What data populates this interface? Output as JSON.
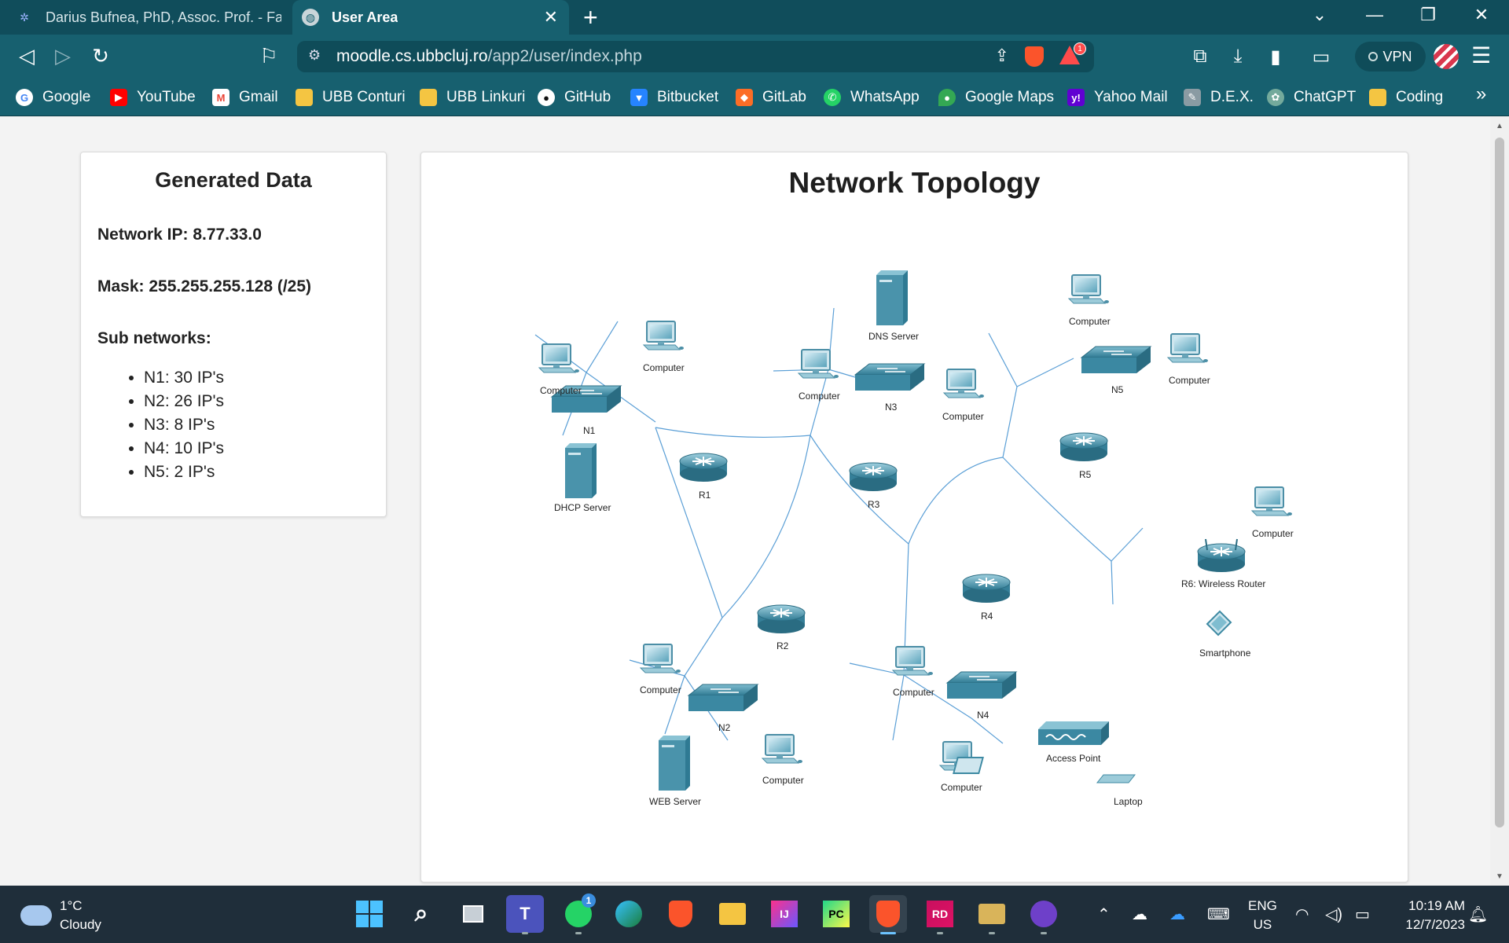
{
  "browser": {
    "tabs": [
      {
        "title": "Darius Bufnea, PhD, Assoc. Prof. - Facu",
        "active": false
      },
      {
        "title": "User Area",
        "active": true
      }
    ],
    "url_host": "moodle.cs.ubbcluj.ro",
    "url_path": "/app2/user/index.php",
    "brave_badge": "1",
    "vpn_label": "VPN",
    "bookmarks": [
      {
        "label": "Google",
        "icon": "google-icon",
        "color": "#4285f4"
      },
      {
        "label": "YouTube",
        "icon": "youtube-icon",
        "color": "#ff0000"
      },
      {
        "label": "Gmail",
        "icon": "gmail-icon",
        "color": "#ea4335"
      },
      {
        "label": "UBB Conturi",
        "icon": "folder-icon",
        "color": "#f4c542"
      },
      {
        "label": "UBB Linkuri",
        "icon": "folder-icon",
        "color": "#f4c542"
      },
      {
        "label": "GitHub",
        "icon": "github-icon",
        "color": "#ffffff"
      },
      {
        "label": "Bitbucket",
        "icon": "bitbucket-icon",
        "color": "#2684ff"
      },
      {
        "label": "GitLab",
        "icon": "gitlab-icon",
        "color": "#fc6d26"
      },
      {
        "label": "WhatsApp",
        "icon": "whatsapp-icon",
        "color": "#25d366"
      },
      {
        "label": "Google Maps",
        "icon": "maps-icon",
        "color": "#34a853"
      },
      {
        "label": "Yahoo Mail",
        "icon": "yahoo-icon",
        "color": "#6001d2"
      },
      {
        "label": "D.E.X.",
        "icon": "dex-icon",
        "color": "#8a9ba3"
      },
      {
        "label": "ChatGPT",
        "icon": "chatgpt-icon",
        "color": "#74aa9c"
      },
      {
        "label": "Coding",
        "icon": "folder-icon",
        "color": "#f4c542"
      }
    ]
  },
  "generated": {
    "title": "Generated Data",
    "network_ip": "Network IP: 8.77.33.0",
    "mask": "Mask: 255.255.255.128 (/25)",
    "subnets_label": "Sub networks:",
    "subnets": [
      "N1: 30 IP's",
      "N2: 26 IP's",
      "N3: 8 IP's",
      "N4: 10 IP's",
      "N5: 2 IP's"
    ]
  },
  "topology": {
    "title": "Network Topology",
    "labels": {
      "n1": "N1",
      "n2": "N2",
      "n3": "N3",
      "n4": "N4",
      "n5": "N5",
      "r1": "R1",
      "r2": "R2",
      "r3": "R3",
      "r4": "R4",
      "r5": "R5",
      "r6": "R6: Wireless Router",
      "computer": "Computer",
      "dhcp": "DHCP Server",
      "dns": "DNS Server",
      "web": "WEB Server",
      "ap": "Access Point",
      "laptop": "Laptop",
      "smartphone": "Smartphone"
    }
  },
  "taskbar": {
    "temperature": "1°C",
    "condition": "Cloudy",
    "language": "ENG",
    "region": "US",
    "time": "10:19 AM",
    "date": "12/7/2023",
    "whatsapp_badge": "1"
  },
  "colors": {
    "chrome": "#17606f",
    "tab_bar": "#104d5b",
    "link": "#4a90d9",
    "device": "#3e8aa3"
  }
}
